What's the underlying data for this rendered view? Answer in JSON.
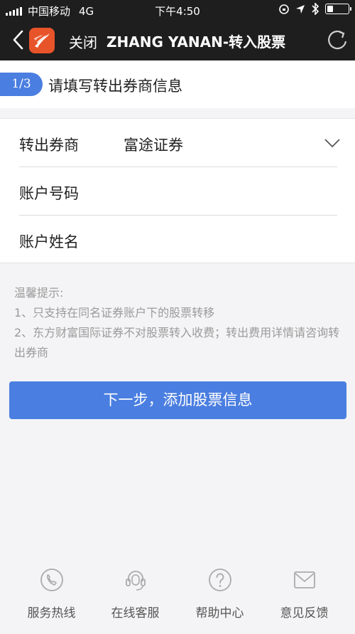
{
  "status_bar": {
    "carrier": "中国移动",
    "network": "4G",
    "time": "下午4:50"
  },
  "nav": {
    "close_label": "关闭",
    "title": "ZHANG YANAN-转入股票",
    "icons": [
      "chevron-left-icon",
      "app-logo",
      "refresh-icon"
    ]
  },
  "step": {
    "badge": "1/3",
    "title": "请填写转出券商信息"
  },
  "form": {
    "broker_label": "转出券商",
    "broker_value": "富途证券",
    "account_number_label": "账户号码",
    "account_number_value": "",
    "account_name_label": "账户姓名",
    "account_name_value": ""
  },
  "tips": {
    "title": "温馨提示:",
    "line1": "1、只支持在同名证券账户下的股票转移",
    "line2": "2、东方财富国际证券不对股票转入收费；转出费用详情请咨询转出券商"
  },
  "next_button_label": "下一步，添加股票信息",
  "tabs": [
    {
      "label": "服务热线",
      "icon": "phone-icon"
    },
    {
      "label": "在线客服",
      "icon": "headset-icon"
    },
    {
      "label": "帮助中心",
      "icon": "help-icon"
    },
    {
      "label": "意见反馈",
      "icon": "mail-icon"
    }
  ],
  "colors": {
    "accent": "#4a7ee0",
    "nav_bg": "#1e1e1e",
    "logo": "#e8542a",
    "tip_text": "#9a9a9a"
  }
}
